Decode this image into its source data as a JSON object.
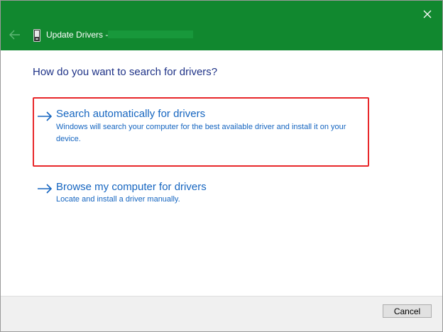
{
  "colors": {
    "titlebar": "#11882f",
    "heading": "#1e3287",
    "link": "#1565c0",
    "highlight": "#e8272a",
    "footer": "#f0f0f0"
  },
  "window": {
    "title": "Update Drivers -",
    "close_icon": "close-icon",
    "back_icon": "back-arrow-icon",
    "device_icon": "device-icon"
  },
  "main": {
    "heading": "How do you want to search for drivers?",
    "options": [
      {
        "icon": "right-arrow-icon",
        "title": "Search automatically for drivers",
        "description": "Windows will search your computer for the best available driver and install it on your device.",
        "highlighted": true
      },
      {
        "icon": "right-arrow-icon",
        "title": "Browse my computer for drivers",
        "description": "Locate and install a driver manually.",
        "highlighted": false
      }
    ]
  },
  "footer": {
    "cancel_label": "Cancel"
  }
}
